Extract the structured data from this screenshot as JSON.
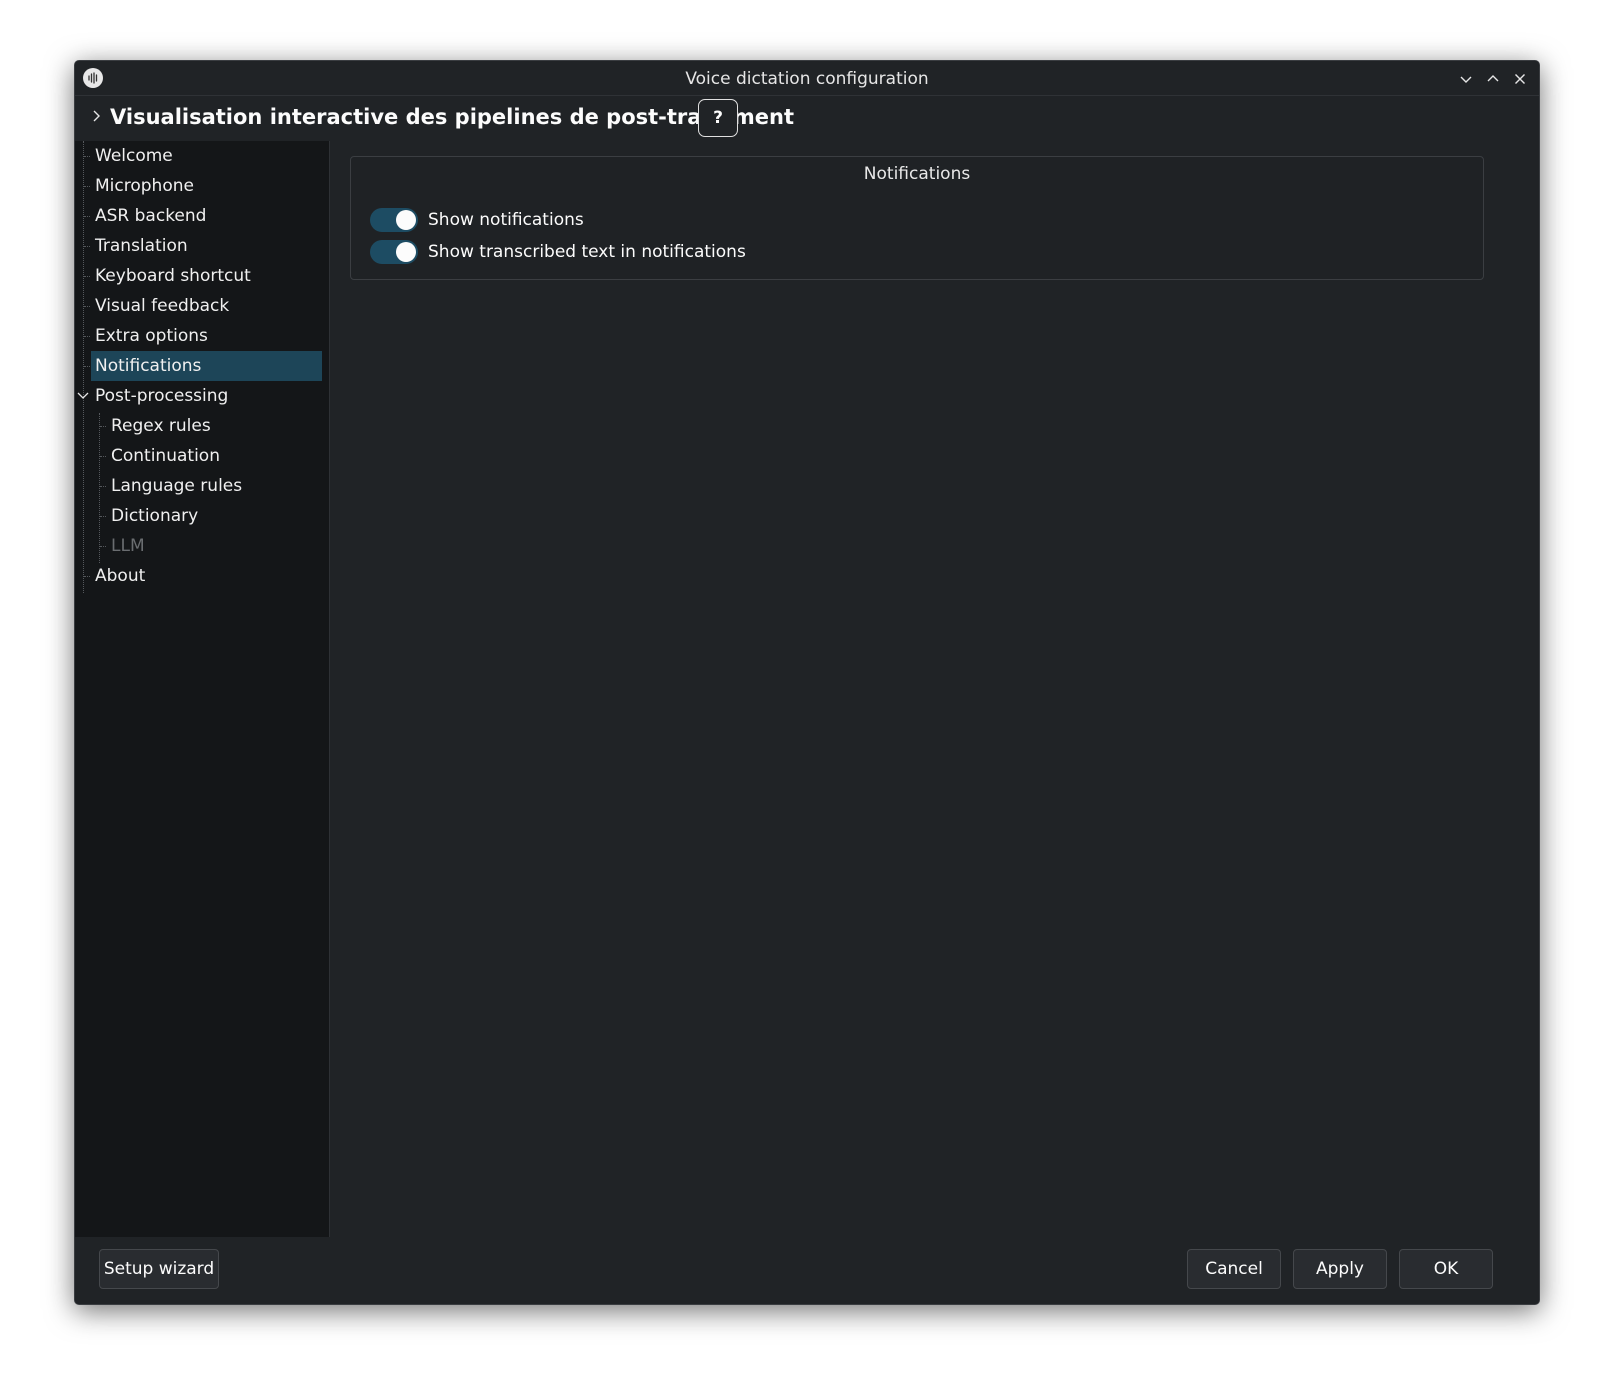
{
  "window": {
    "title": "Voice dictation configuration",
    "app_icon": "waveform-icon",
    "controls": [
      "minimize-icon",
      "maximize-icon",
      "close-icon"
    ]
  },
  "breadcrumb": {
    "title": "Visualisation interactive des pipelines de post-traitement",
    "help_label": "?"
  },
  "sidebar": {
    "items": [
      {
        "label": "Welcome"
      },
      {
        "label": "Microphone"
      },
      {
        "label": "ASR backend"
      },
      {
        "label": "Translation"
      },
      {
        "label": "Keyboard shortcut"
      },
      {
        "label": "Visual feedback"
      },
      {
        "label": "Extra options"
      },
      {
        "label": "Notifications",
        "selected": true
      },
      {
        "label": "Post-processing",
        "expanded": true
      },
      {
        "label": "Regex rules"
      },
      {
        "label": "Continuation"
      },
      {
        "label": "Language rules"
      },
      {
        "label": "Dictionary"
      },
      {
        "label": "LLM",
        "disabled": true
      },
      {
        "label": "About"
      }
    ]
  },
  "main": {
    "group_title": "Notifications",
    "toggles": [
      {
        "label": "Show notifications",
        "on": true
      },
      {
        "label": "Show transcribed text in notifications",
        "on": true
      }
    ]
  },
  "footer": {
    "setup_wizard": "Setup wizard",
    "cancel": "Cancel",
    "apply": "Apply",
    "ok": "OK"
  },
  "colors": {
    "window_bg": "#202326",
    "sidebar_bg": "#141618",
    "selection": "#1d4558",
    "toggle_on": "#1d4c63"
  }
}
